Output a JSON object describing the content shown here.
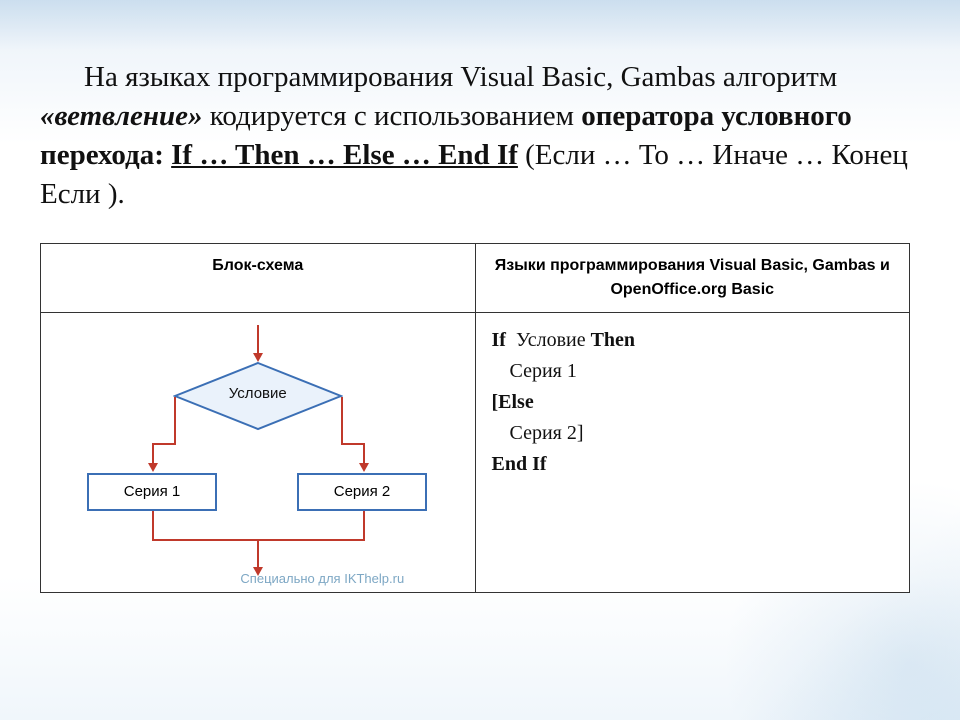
{
  "paragraph": {
    "text1": "На языках программирования Visual Basic, Gambas алгоритм ",
    "italic": "«ветвление»",
    "text2": " кодируется с использованием ",
    "bold": "оператора условного перехода:",
    "spacer": "    ",
    "underline": "If … Then … Else … End If",
    "text3": "(Если … То … Иначе … Конец Если ).",
    "spacer2": " "
  },
  "table": {
    "header_left": "Блок-схема",
    "header_right": "Языки программирования Visual Basic, Gambas и OpenOffice.org Basic"
  },
  "flowchart": {
    "condition": "Условие",
    "branch_left": "Серия 1",
    "branch_right": "Серия 2"
  },
  "code": {
    "l1a": "If  Условие ",
    "l1b": "Then",
    "l2": "Серия 1",
    "l3": "[Else",
    "l4": "Серия 2]",
    "l5a": "End  If"
  },
  "watermark": "Специально для IKThelp.ru"
}
